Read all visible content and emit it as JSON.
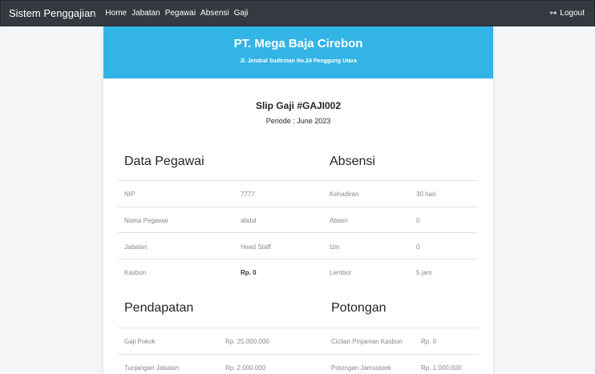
{
  "navbar": {
    "brand": "Sistem Penggajian",
    "links": [
      "Home",
      "Jabatan",
      "Pegawai",
      "Absensi",
      "Gaji"
    ],
    "logout": "Logout"
  },
  "company": {
    "name": "PT. Mega Baja Cirebon",
    "address": "Jl. Jendral Sudirman No.24 Penggung Utara"
  },
  "slip": {
    "title": "Slip Gaji #GAJI002",
    "periode": "Periode : June 2023"
  },
  "data_pegawai": {
    "title": "Data Pegawai",
    "rows": [
      {
        "label": "NIP",
        "value": "7777"
      },
      {
        "label": "Nama Pegawai",
        "value": "abdul"
      },
      {
        "label": "Jabatan",
        "value": "Head Staff"
      },
      {
        "label": "Kasbon",
        "value": "Rp. 0"
      }
    ]
  },
  "absensi": {
    "title": "Absensi",
    "rows": [
      {
        "label": "Kehadiran",
        "value": "30 hari"
      },
      {
        "label": "Absen",
        "value": "0"
      },
      {
        "label": "Izin",
        "value": "0"
      },
      {
        "label": "Lembur",
        "value": "5 jam"
      }
    ]
  },
  "pendapatan": {
    "title": "Pendapatan",
    "rows": [
      {
        "label": "Gaji Pokok",
        "value": "Rp. 25.000.000"
      },
      {
        "label": "Tunjangan Jabatan",
        "value": "Rp. 2.000.000"
      }
    ]
  },
  "potongan": {
    "title": "Potongan",
    "rows": [
      {
        "label": "Cicilan Pinjaman Kasbon",
        "value": "Rp. 0"
      },
      {
        "label": "Potongan Jamsostek",
        "value": "Rp. 1.000.000"
      }
    ]
  }
}
